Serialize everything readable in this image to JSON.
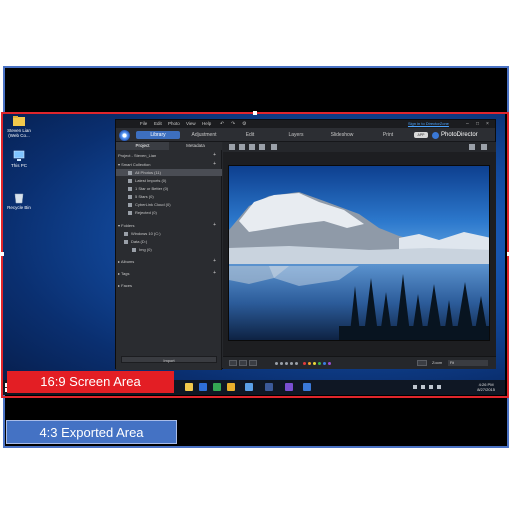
{
  "annotations": {
    "screen_area_label": "16:9 Screen Area",
    "exported_area_label": "4:3 Exported Area",
    "screen_color": "#e31e24",
    "export_color": "#4472c4"
  },
  "desktop": {
    "icons": [
      {
        "label": "Steven Lian (Web Co...",
        "icon": "user-folder-icon"
      },
      {
        "label": "This PC",
        "icon": "computer-icon"
      },
      {
        "label": "Recycle Bin",
        "icon": "recycle-bin-icon"
      }
    ]
  },
  "app": {
    "menu": [
      "File",
      "Edit",
      "Photo",
      "View",
      "Help"
    ],
    "signin": "Sign in to DirectorZone",
    "window_controls": [
      "–",
      "□",
      "×"
    ],
    "modes": [
      "Library",
      "Adjustment",
      "Edit",
      "Layers",
      "Slideshow",
      "Print"
    ],
    "badge": "APP",
    "brand": "PhotoDirector",
    "panel_tabs": [
      "Project",
      "Metadata"
    ],
    "project_title": "Project - Steven_Lian",
    "smart_collection": "Smart Collection",
    "collections": [
      "All Photos (11)",
      "Latest Imports (0)",
      "1 Star or Better (0)",
      "5 Stars (0)",
      "CyberLink Cloud (0)",
      "Rejected (0)"
    ],
    "folders_label": "Folders",
    "folders": [
      "Windows 10 (C:)",
      "Data (D:)",
      "Img (0)"
    ],
    "albums_label": "Albums",
    "tags_label": "Tags",
    "faces_label": "Faces",
    "import_label": "Import",
    "zoom_label": "Zoom",
    "zoom_value": "Fit",
    "color_labels": [
      "#e23b3b",
      "#f0a030",
      "#e9d93a",
      "#3db74a",
      "#3a7ee0",
      "#9b4fd0"
    ]
  },
  "taskbar": {
    "time": "4:26 PM",
    "date": "8/27/2015"
  }
}
